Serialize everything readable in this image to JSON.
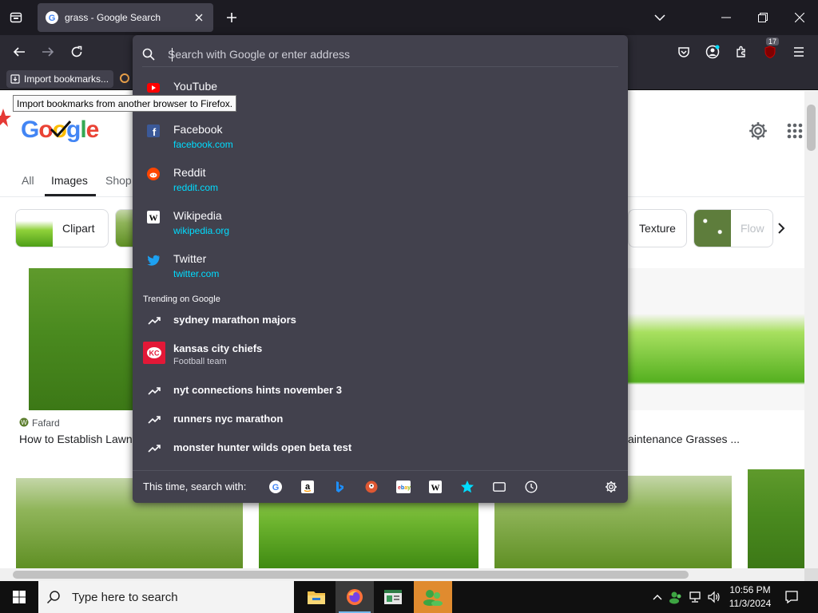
{
  "browser": {
    "tab_title": "grass - Google Search",
    "url_placeholder": "Search with Google or enter address",
    "extensions_badge": "17",
    "bookmark_import_label": "Import bookmarks...",
    "tooltip": "Import bookmarks from another browser to Firefox."
  },
  "suggestions": [
    {
      "title": "YouTube",
      "url": "",
      "icon": "youtube-icon"
    },
    {
      "title": "Facebook",
      "url": "facebook.com",
      "icon": "facebook-icon"
    },
    {
      "title": "Reddit",
      "url": "reddit.com",
      "icon": "reddit-icon"
    },
    {
      "title": "Wikipedia",
      "url": "wikipedia.org",
      "icon": "wikipedia-icon"
    },
    {
      "title": "Twitter",
      "url": "twitter.com",
      "icon": "twitter-icon"
    }
  ],
  "trending": {
    "label": "Trending on Google",
    "items": [
      {
        "title": "sydney marathon majors",
        "subtitle": ""
      },
      {
        "title": "kansas city chiefs",
        "subtitle": "Football team"
      },
      {
        "title": "nyt connections hints november 3",
        "subtitle": ""
      },
      {
        "title": "runners nyc marathon",
        "subtitle": ""
      },
      {
        "title": "monster hunter wilds open beta test",
        "subtitle": ""
      }
    ]
  },
  "search_with_label": "This time, search with:",
  "google": {
    "tabs": [
      "All",
      "Images",
      "Shop"
    ],
    "chips": {
      "clipart": "Clipart",
      "texture": "Texture",
      "flowers": "Flow"
    },
    "results": [
      {
        "source": "Fafard",
        "title": "How to Establish Lawn"
      },
      {
        "source": "",
        "title": "aintenance Grasses ..."
      }
    ]
  },
  "taskbar": {
    "search_placeholder": "Type here to search",
    "time": "10:56 PM",
    "date": "11/3/2024"
  },
  "colors": {
    "url_highlight": "#00ddff",
    "dropdown_bg": "#42414d",
    "toolbar_bg": "#2b2a33",
    "tabbar_bg": "#1c1b22"
  }
}
